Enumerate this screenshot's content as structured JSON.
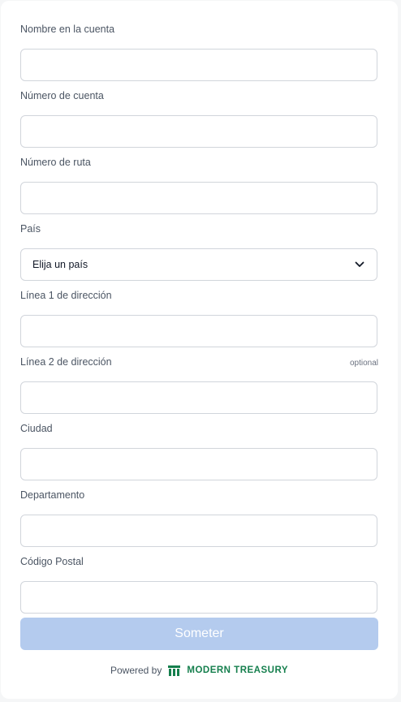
{
  "form": {
    "fields": [
      {
        "label": "Nombre en la cuenta",
        "value": "",
        "placeholder": ""
      },
      {
        "label": "Número de cuenta",
        "value": "",
        "placeholder": ""
      },
      {
        "label": "Número de ruta",
        "value": "",
        "placeholder": ""
      },
      {
        "label": "País",
        "value": "Elija un país",
        "placeholder": ""
      },
      {
        "label": "Línea 1 de dirección",
        "value": "",
        "placeholder": ""
      },
      {
        "label": "Línea 2 de dirección",
        "value": "",
        "placeholder": "",
        "hint": "optional"
      },
      {
        "label": "Ciudad",
        "value": "",
        "placeholder": ""
      },
      {
        "label": "Departamento",
        "value": "",
        "placeholder": ""
      },
      {
        "label": "Código Postal",
        "value": "",
        "placeholder": ""
      }
    ],
    "submit_label": "Someter"
  },
  "footer": {
    "powered_by": "Powered by",
    "brand_name": "MODERN TREASURY",
    "brand_icon": "modern-treasury-logo"
  },
  "colors": {
    "submit_bg": "#b4cbee",
    "brand": "#157f4d",
    "border": "#d1d5db"
  }
}
